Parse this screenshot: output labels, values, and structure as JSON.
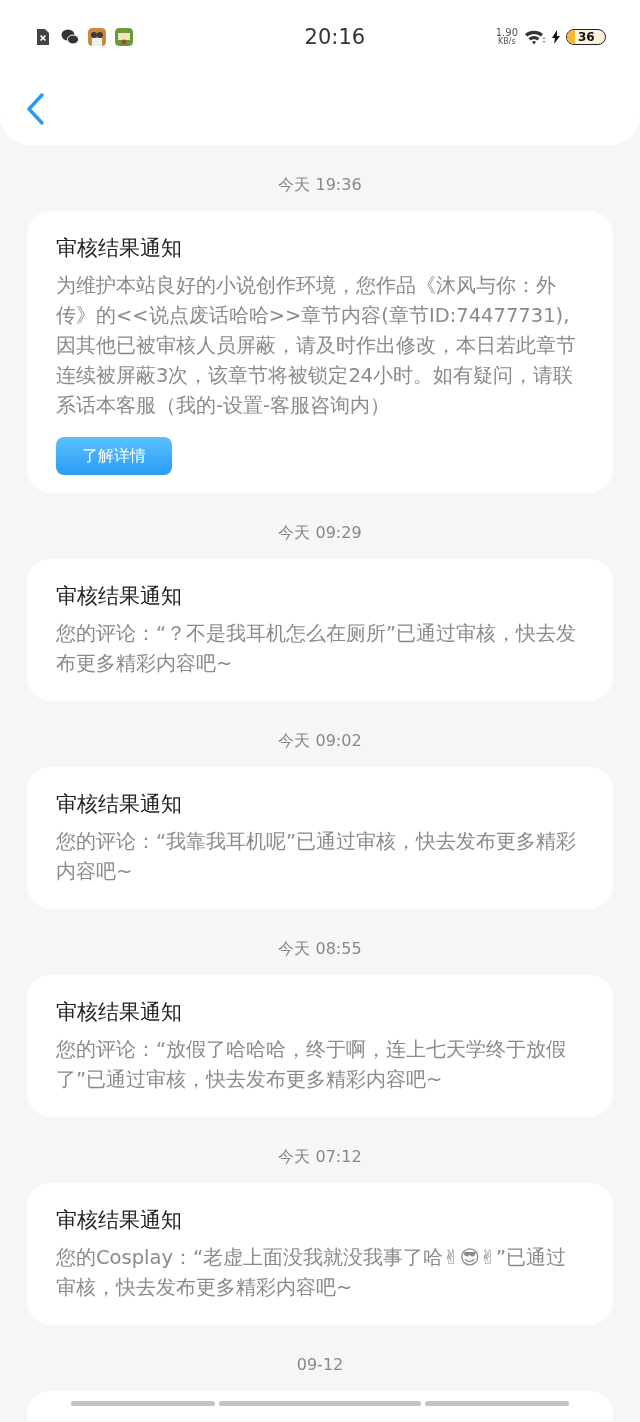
{
  "status_bar": {
    "time": "20:16",
    "net_speed": "1.90",
    "net_unit": "KB/s",
    "battery": "36"
  },
  "messages": [
    {
      "kind": "card",
      "timestamp": "今天 19:36",
      "title": "审核结果通知",
      "body": "为维护本站良好的小说创作环境，您作品《沐风与你：外传》的<<说点废话哈哈>>章节内容(章节ID:74477731),因其他已被审核人员屏蔽，请及时作出修改，本日若此章节连续被屏蔽3次，该章节将被锁定24小时。如有疑问，请联系话本客服（我的-设置-客服咨询内）",
      "button": "了解详情"
    },
    {
      "kind": "card",
      "timestamp": "今天 09:29",
      "title": "审核结果通知",
      "body": "您的评论：“？不是我耳机怎么在厕所”已通过审核，快去发布更多精彩内容吧~"
    },
    {
      "kind": "card",
      "timestamp": "今天 09:02",
      "title": "审核结果通知",
      "body": "您的评论：“我靠我耳机呢”已通过审核，快去发布更多精彩内容吧~"
    },
    {
      "kind": "card",
      "timestamp": "今天 08:55",
      "title": "审核结果通知",
      "body": "您的评论：“放假了哈哈哈，终于啊，连上七天学终于放假了”已通过审核，快去发布更多精彩内容吧~"
    },
    {
      "kind": "card",
      "timestamp": "今天 07:12",
      "title": "审核结果通知",
      "body": "您的Cosplay：“老虚上面没我就没我事了哈✌😎✌”已通过审核，快去发布更多精彩内容吧~"
    },
    {
      "kind": "partial",
      "timestamp": "09-12"
    }
  ]
}
